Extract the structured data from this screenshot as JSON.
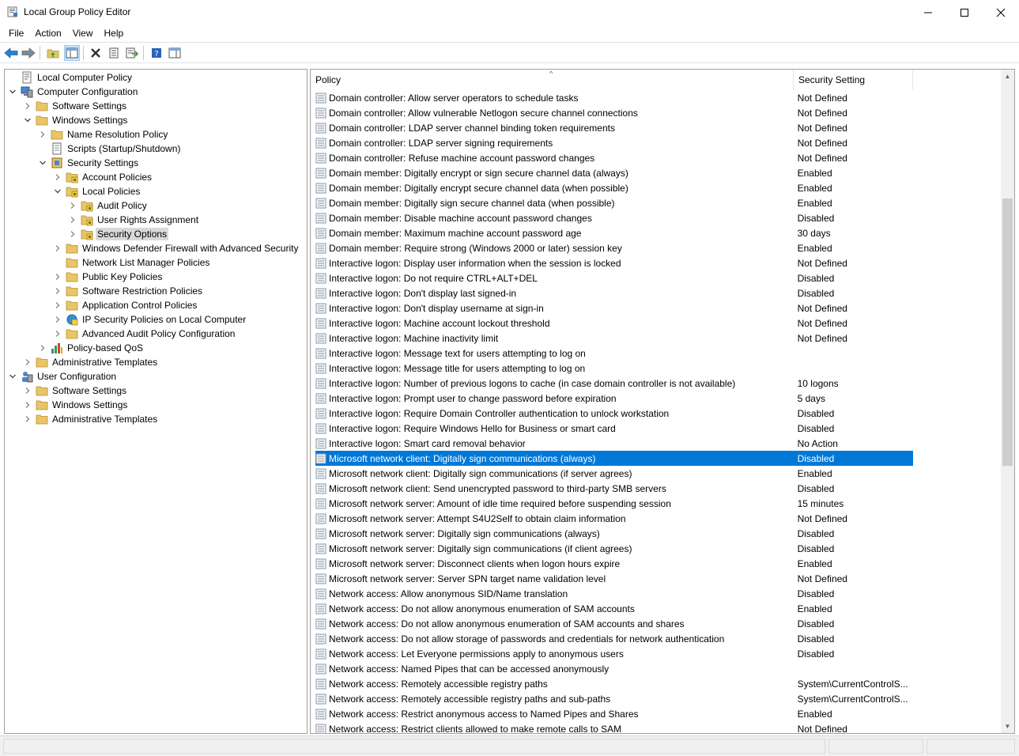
{
  "window": {
    "title": "Local Group Policy Editor"
  },
  "menu": [
    "File",
    "Action",
    "View",
    "Help"
  ],
  "toolbar": {
    "buttons": [
      "back-icon",
      "forward-icon",
      "up-folder-icon",
      "show-hide-tree-icon",
      "delete-icon",
      "properties-icon",
      "export-list-icon",
      "help-icon",
      "show-action-pane-icon"
    ]
  },
  "tree": [
    {
      "label": "Local Computer Policy",
      "level": 0,
      "icon": "policy",
      "exp": "none"
    },
    {
      "label": "Computer Configuration",
      "level": 0,
      "icon": "computer",
      "exp": "open"
    },
    {
      "label": "Software Settings",
      "level": 1,
      "icon": "folder",
      "exp": "closed"
    },
    {
      "label": "Windows Settings",
      "level": 1,
      "icon": "folder",
      "exp": "open"
    },
    {
      "label": "Name Resolution Policy",
      "level": 2,
      "icon": "folder",
      "exp": "closed"
    },
    {
      "label": "Scripts (Startup/Shutdown)",
      "level": 2,
      "icon": "script",
      "exp": "none"
    },
    {
      "label": "Security Settings",
      "level": 2,
      "icon": "security",
      "exp": "open"
    },
    {
      "label": "Account Policies",
      "level": 3,
      "icon": "secfolder",
      "exp": "closed"
    },
    {
      "label": "Local Policies",
      "level": 3,
      "icon": "secfolder",
      "exp": "open"
    },
    {
      "label": "Audit Policy",
      "level": 4,
      "icon": "secfolder",
      "exp": "closed"
    },
    {
      "label": "User Rights Assignment",
      "level": 4,
      "icon": "secfolder",
      "exp": "closed"
    },
    {
      "label": "Security Options",
      "level": 4,
      "icon": "secfolder",
      "exp": "closed",
      "selected": true
    },
    {
      "label": "Windows Defender Firewall with Advanced Security",
      "level": 3,
      "icon": "folder",
      "exp": "closed"
    },
    {
      "label": "Network List Manager Policies",
      "level": 3,
      "icon": "folder",
      "exp": "none"
    },
    {
      "label": "Public Key Policies",
      "level": 3,
      "icon": "folder",
      "exp": "closed"
    },
    {
      "label": "Software Restriction Policies",
      "level": 3,
      "icon": "folder",
      "exp": "closed"
    },
    {
      "label": "Application Control Policies",
      "level": 3,
      "icon": "folder",
      "exp": "closed"
    },
    {
      "label": "IP Security Policies on Local Computer",
      "level": 3,
      "icon": "ipsec",
      "exp": "closed"
    },
    {
      "label": "Advanced Audit Policy Configuration",
      "level": 3,
      "icon": "folder",
      "exp": "closed"
    },
    {
      "label": "Policy-based QoS",
      "level": 2,
      "icon": "chart",
      "exp": "closed"
    },
    {
      "label": "Administrative Templates",
      "level": 1,
      "icon": "folder",
      "exp": "closed"
    },
    {
      "label": "User Configuration",
      "level": 0,
      "icon": "user",
      "exp": "open"
    },
    {
      "label": "Software Settings",
      "level": 1,
      "icon": "folder",
      "exp": "closed"
    },
    {
      "label": "Windows Settings",
      "level": 1,
      "icon": "folder",
      "exp": "closed"
    },
    {
      "label": "Administrative Templates",
      "level": 1,
      "icon": "folder",
      "exp": "closed"
    }
  ],
  "list": {
    "columns": [
      "Policy",
      "Security Setting"
    ],
    "rows": [
      [
        "Domain controller: Allow server operators to schedule tasks",
        "Not Defined"
      ],
      [
        "Domain controller: Allow vulnerable Netlogon secure channel connections",
        "Not Defined"
      ],
      [
        "Domain controller: LDAP server channel binding token requirements",
        "Not Defined"
      ],
      [
        "Domain controller: LDAP server signing requirements",
        "Not Defined"
      ],
      [
        "Domain controller: Refuse machine account password changes",
        "Not Defined"
      ],
      [
        "Domain member: Digitally encrypt or sign secure channel data (always)",
        "Enabled"
      ],
      [
        "Domain member: Digitally encrypt secure channel data (when possible)",
        "Enabled"
      ],
      [
        "Domain member: Digitally sign secure channel data (when possible)",
        "Enabled"
      ],
      [
        "Domain member: Disable machine account password changes",
        "Disabled"
      ],
      [
        "Domain member: Maximum machine account password age",
        "30 days"
      ],
      [
        "Domain member: Require strong (Windows 2000 or later) session key",
        "Enabled"
      ],
      [
        "Interactive logon: Display user information when the session is locked",
        "Not Defined"
      ],
      [
        "Interactive logon: Do not require CTRL+ALT+DEL",
        "Disabled"
      ],
      [
        "Interactive logon: Don't display last signed-in",
        "Disabled"
      ],
      [
        "Interactive logon: Don't display username at sign-in",
        "Not Defined"
      ],
      [
        "Interactive logon: Machine account lockout threshold",
        "Not Defined"
      ],
      [
        "Interactive logon: Machine inactivity limit",
        "Not Defined"
      ],
      [
        "Interactive logon: Message text for users attempting to log on",
        ""
      ],
      [
        "Interactive logon: Message title for users attempting to log on",
        ""
      ],
      [
        "Interactive logon: Number of previous logons to cache (in case domain controller is not available)",
        "10 logons"
      ],
      [
        "Interactive logon: Prompt user to change password before expiration",
        "5 days"
      ],
      [
        "Interactive logon: Require Domain Controller authentication to unlock workstation",
        "Disabled"
      ],
      [
        "Interactive logon: Require Windows Hello for Business or smart card",
        "Disabled"
      ],
      [
        "Interactive logon: Smart card removal behavior",
        "No Action"
      ],
      [
        "Microsoft network client: Digitally sign communications (always)",
        "Disabled"
      ],
      [
        "Microsoft network client: Digitally sign communications (if server agrees)",
        "Enabled"
      ],
      [
        "Microsoft network client: Send unencrypted password to third-party SMB servers",
        "Disabled"
      ],
      [
        "Microsoft network server: Amount of idle time required before suspending session",
        "15 minutes"
      ],
      [
        "Microsoft network server: Attempt S4U2Self to obtain claim information",
        "Not Defined"
      ],
      [
        "Microsoft network server: Digitally sign communications (always)",
        "Disabled"
      ],
      [
        "Microsoft network server: Digitally sign communications (if client agrees)",
        "Disabled"
      ],
      [
        "Microsoft network server: Disconnect clients when logon hours expire",
        "Enabled"
      ],
      [
        "Microsoft network server: Server SPN target name validation level",
        "Not Defined"
      ],
      [
        "Network access: Allow anonymous SID/Name translation",
        "Disabled"
      ],
      [
        "Network access: Do not allow anonymous enumeration of SAM accounts",
        "Enabled"
      ],
      [
        "Network access: Do not allow anonymous enumeration of SAM accounts and shares",
        "Disabled"
      ],
      [
        "Network access: Do not allow storage of passwords and credentials for network authentication",
        "Disabled"
      ],
      [
        "Network access: Let Everyone permissions apply to anonymous users",
        "Disabled"
      ],
      [
        "Network access: Named Pipes that can be accessed anonymously",
        ""
      ],
      [
        "Network access: Remotely accessible registry paths",
        "System\\CurrentControlS..."
      ],
      [
        "Network access: Remotely accessible registry paths and sub-paths",
        "System\\CurrentControlS..."
      ],
      [
        "Network access: Restrict anonymous access to Named Pipes and Shares",
        "Enabled"
      ],
      [
        "Network access: Restrict clients allowed to make remote calls to SAM",
        "Not Defined"
      ]
    ],
    "selected_index": 24
  },
  "colors": {
    "selection": "#0078d7",
    "tree_selection": "#d9d9d9",
    "folder": "#e8c566"
  }
}
